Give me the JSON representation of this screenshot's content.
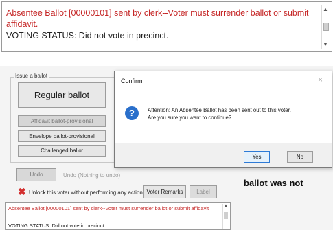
{
  "top_status": {
    "line1": "Absentee Ballot [00000101] sent by clerk--Voter must surrender ballot or submit affidavit.",
    "line2": "VOTING STATUS: Did not vote in precinct."
  },
  "issue_ballot": {
    "group_label": "Issue a ballot",
    "regular": "Regular ballot",
    "affidavit": "Affidavit ballot-provisional",
    "envelope": "Envelope ballot-provisional",
    "challenged": "Challenged ballot"
  },
  "undo": {
    "button": "Undo",
    "status": "Undo (Nothing to undo)"
  },
  "actions": {
    "unlock": "Unlock this voter without performing any action",
    "remarks": "Voter Remarks",
    "label": "Label"
  },
  "caption": "ballot was not",
  "bottom_status": {
    "line1": "Absentee Ballot [00000101] sent by clerk--Voter must surrender ballot or submit affidavit",
    "line2": "VOTING STATUS: Did not vote in precinct"
  },
  "dialog": {
    "title": "Confirm",
    "message1": "Attention: An Absentee Ballot has been sent out to this voter.",
    "message2": "Are you sure you want to continue?",
    "yes": "Yes",
    "no": "No"
  },
  "icons": {
    "question": "?",
    "close": "×",
    "unlock_x": "✖",
    "scroll_up": "▲",
    "scroll_down": "▼"
  },
  "colors": {
    "status_red": "#c62828",
    "question_blue": "#2a6fcb",
    "unlock_red": "#d32f2f"
  }
}
